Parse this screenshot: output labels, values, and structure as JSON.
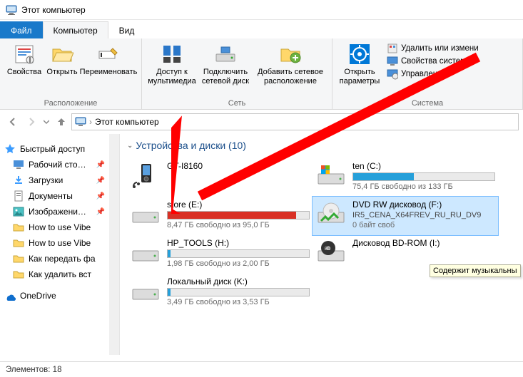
{
  "window": {
    "title": "Этот компьютер"
  },
  "tabs": {
    "file": "Файл",
    "computer": "Компьютер",
    "view": "Вид"
  },
  "ribbon": {
    "location": {
      "label": "Расположение",
      "properties": "Свойства",
      "open": "Открыть",
      "rename": "Переименовать"
    },
    "network": {
      "label": "Сеть",
      "media": "Доступ к\nмультимедиа",
      "map_drive": "Подключить\nсетевой диск",
      "add_location": "Добавить сетевое\nрасположение"
    },
    "system": {
      "label": "Система",
      "open_params_top": "Открыть",
      "open_params_bottom": "параметры",
      "uninstall": "Удалить или измени",
      "sysprops": "Свойства системы",
      "manage": "Управление"
    }
  },
  "address": {
    "text": "Этот компьютер"
  },
  "sidebar": {
    "quick": "Быстрый доступ",
    "items": [
      "Рабочий сто…",
      "Загрузки",
      "Документы",
      "Изображени…",
      "How to use Vibe",
      "How to use Vibe",
      "Как передать фа",
      "Как удалить вст"
    ],
    "onedrive": "OneDrive"
  },
  "section": {
    "title": "Устройства и диски (10)"
  },
  "drives": [
    {
      "name": "GT-I8160",
      "sub": "",
      "kind": "device",
      "fill": null,
      "color": null
    },
    {
      "name": "ten (C:)",
      "sub": "75,4 ГБ свободно из 133 ГБ",
      "kind": "drive",
      "fill": 43,
      "color": "#26a0da"
    },
    {
      "name": "store (E:)",
      "sub": "8,47 ГБ свободно из 95,0 ГБ",
      "kind": "drive",
      "fill": 91,
      "color": "#d93025"
    },
    {
      "name": "DVD RW дисковод (F:)",
      "sub2": "IR5_CENA_X64FREV_RU_RU_DV9",
      "sub": "0 байт своб",
      "kind": "dvd",
      "fill": null,
      "color": null,
      "selected": true
    },
    {
      "name": "HP_TOOLS (H:)",
      "sub": "1,98 ГБ свободно из 2,00 ГБ",
      "kind": "drive",
      "fill": 2,
      "color": "#26a0da"
    },
    {
      "name": "Дисковод BD-ROM (I:)",
      "sub": "",
      "kind": "bd",
      "fill": null,
      "color": null
    },
    {
      "name": "Локальный диск (K:)",
      "sub": "3,49 ГБ свободно из 3,53 ГБ",
      "kind": "drive",
      "fill": 2,
      "color": "#26a0da"
    }
  ],
  "tooltip": "Содержит музыкальны",
  "status": {
    "items": "Элементов: 18"
  }
}
